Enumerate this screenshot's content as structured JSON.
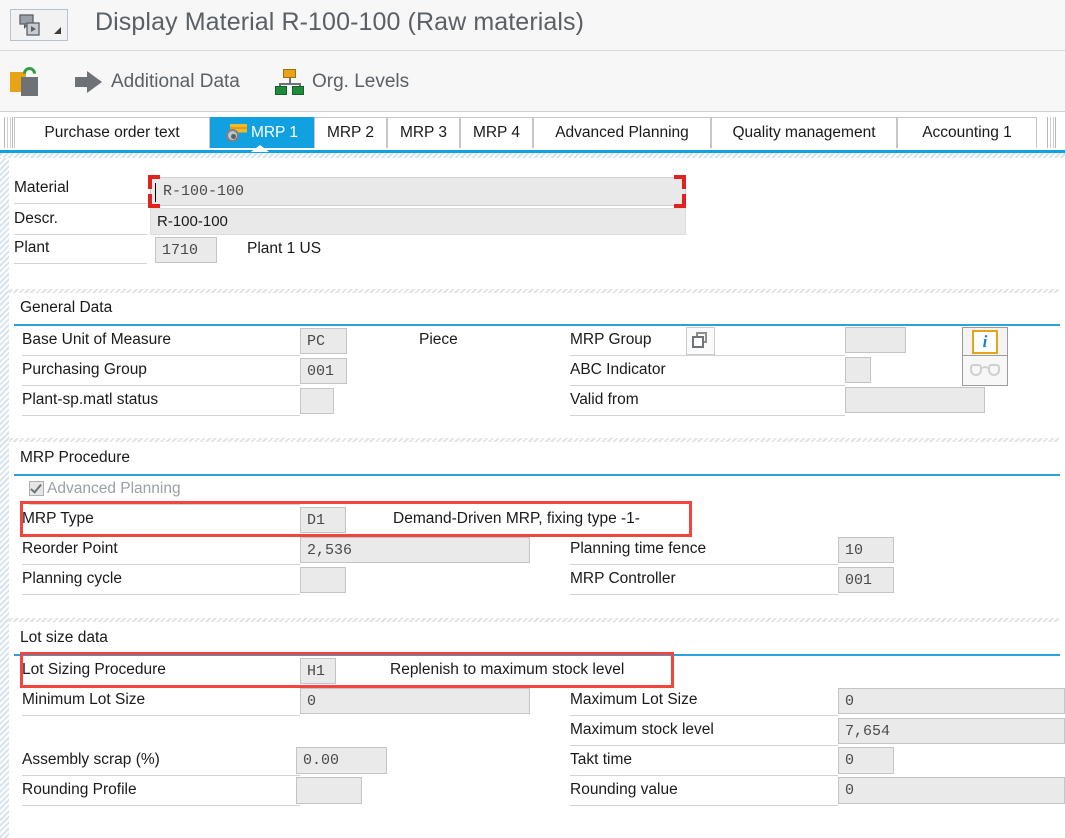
{
  "window": {
    "title": "Display Material R-100-100 (Raw materials)",
    "menu_button_icon": "sap-menu-icon"
  },
  "toolbar": {
    "items": [
      {
        "label": "",
        "icon": "copy-refresh-icon"
      },
      {
        "label": "Additional Data",
        "icon": "right-arrow-icon"
      },
      {
        "label": "Org. Levels",
        "icon": "org-levels-icon"
      }
    ],
    "additional_data_label": "Additional Data",
    "org_levels_label": "Org. Levels"
  },
  "tabs": {
    "items": [
      {
        "label": "Purchase order text",
        "active": false
      },
      {
        "label": "MRP 1",
        "active": true,
        "icon": "mrp-tab-icon"
      },
      {
        "label": "MRP 2",
        "active": false
      },
      {
        "label": "MRP 3",
        "active": false
      },
      {
        "label": "MRP 4",
        "active": false
      },
      {
        "label": "Advanced Planning",
        "active": false
      },
      {
        "label": "Quality management",
        "active": false
      },
      {
        "label": "Accounting 1",
        "active": false
      }
    ]
  },
  "header": {
    "material_label": "Material",
    "material_value": "R-100-100",
    "descr_label": "Descr.",
    "descr_value": "R-100-100",
    "plant_label": "Plant",
    "plant_value": "1710",
    "plant_text": "Plant 1 US",
    "info_icon": "info-icon",
    "glasses_icon": "glasses-icon",
    "value_help_icon": "value-help-icon"
  },
  "general_data": {
    "title": "General Data",
    "base_uom_label": "Base Unit of Measure",
    "base_uom_value": "PC",
    "base_uom_text": "Piece",
    "purchasing_group_label": "Purchasing Group",
    "purchasing_group_value": "001",
    "plant_sp_status_label": "Plant-sp.matl status",
    "plant_sp_status_value": "",
    "mrp_group_label": "MRP Group",
    "mrp_group_value": "",
    "abc_indicator_label": "ABC Indicator",
    "abc_indicator_value": "",
    "valid_from_label": "Valid from",
    "valid_from_value": ""
  },
  "mrp_procedure": {
    "title": "MRP Procedure",
    "advanced_planning_label": "Advanced Planning",
    "advanced_planning_checked": true,
    "mrp_type_label": "MRP Type",
    "mrp_type_value": "D1",
    "mrp_type_text": "Demand-Driven MRP, fixing type -1-",
    "reorder_point_label": "Reorder Point",
    "reorder_point_value": "2,536",
    "planning_cycle_label": "Planning cycle",
    "planning_cycle_value": "",
    "planning_time_fence_label": "Planning time fence",
    "planning_time_fence_value": "10",
    "mrp_controller_label": "MRP Controller",
    "mrp_controller_value": "001"
  },
  "lot_size_data": {
    "title": "Lot size data",
    "lot_sizing_procedure_label": "Lot Sizing Procedure",
    "lot_sizing_procedure_value": "H1",
    "lot_sizing_procedure_text": "Replenish to maximum stock level",
    "minimum_lot_size_label": "Minimum Lot Size",
    "minimum_lot_size_value": "0",
    "maximum_lot_size_label": "Maximum Lot Size",
    "maximum_lot_size_value": "0",
    "maximum_stock_level_label": "Maximum stock level",
    "maximum_stock_level_value": "7,654",
    "assembly_scrap_label": "Assembly scrap (%)",
    "assembly_scrap_value": "0.00",
    "takt_time_label": "Takt time",
    "takt_time_value": "0",
    "rounding_profile_label": "Rounding Profile",
    "rounding_profile_value": "",
    "rounding_value_label": "Rounding value",
    "rounding_value_value": "0"
  },
  "annotations": {
    "highlight_color": "#f2453d",
    "focus_color": "#e1231f",
    "accent_color": "#11a0e0"
  }
}
